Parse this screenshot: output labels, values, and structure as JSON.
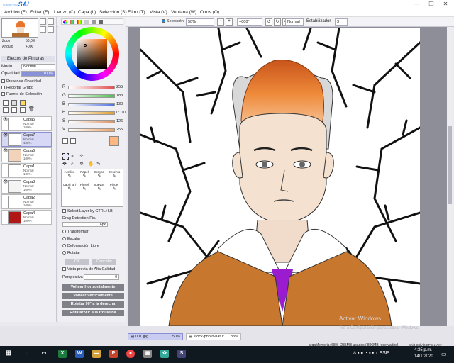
{
  "app": {
    "logo_small": "PaintTool",
    "logo_big": "SAI"
  },
  "window_controls": [
    "—",
    "❐",
    "✕"
  ],
  "menu": [
    "Archivo (F)",
    "Editar (E)",
    "Lienzo (C)",
    "Capa (L)",
    "Selección (S)",
    "Filtro (T)",
    "Vista (V)",
    "Ventana (W)",
    "Otros (O)"
  ],
  "toolbar": {
    "selection_label": "Selección",
    "zoom": "50%",
    "angle": "+000°",
    "mode": "Normal",
    "stabilizer_label": "Estabilizador",
    "stabilizer_value": "3"
  },
  "navigator": {
    "zoom_label": "Zoom",
    "zoom_value": "50,0%",
    "angle_label": "Angulo",
    "angle_value": "+000"
  },
  "paint_effects": {
    "header": "Efectos de Pinturas",
    "mode_label": "Modo",
    "mode_value": "Normal",
    "opacity_label": "Opacidad",
    "opacity_value": "100%",
    "preserve_opacity": "Preservar Opacidad",
    "clip_group": "Recortar Grupo",
    "selection_source": "Fuente de Selección"
  },
  "layers": [
    {
      "name": "Capa5",
      "mode": "Normal",
      "opacity": "100%",
      "visible": true,
      "selected": false,
      "thumb_color": "#ffffff"
    },
    {
      "name": "Capa7",
      "mode": "Normal",
      "opacity": "100%",
      "visible": true,
      "selected": true,
      "thumb_color": "#ffffff"
    },
    {
      "name": "Capa6",
      "mode": "Normal",
      "opacity": "100%",
      "visible": true,
      "selected": false,
      "thumb_color": "#f2d2b8"
    },
    {
      "name": "Capa1",
      "mode": "Normal",
      "opacity": "100%",
      "visible": false,
      "selected": false,
      "thumb_color": "#ffffff"
    },
    {
      "name": "Capa3",
      "mode": "Normal",
      "opacity": "100%",
      "visible": true,
      "selected": false,
      "thumb_color": "#f4f4f4"
    },
    {
      "name": "Capa2",
      "mode": "Normal",
      "opacity": "100%",
      "visible": false,
      "selected": false,
      "thumb_color": "#ffffff"
    },
    {
      "name": "Capa4",
      "mode": "Normal",
      "opacity": "100%",
      "visible": false,
      "selected": false,
      "thumb_color": "#b01818"
    }
  ],
  "color_sliders": [
    {
      "label": "R",
      "value": "255",
      "color": "#e05050"
    },
    {
      "label": "G",
      "value": "183",
      "color": "#50c050"
    },
    {
      "label": "B",
      "value": "130",
      "color": "#5070e0"
    },
    {
      "label": "H",
      "value": "0:110",
      "color": "#e0a030"
    },
    {
      "label": "S",
      "value": "126",
      "color": "#e09060"
    },
    {
      "label": "V",
      "value": "255",
      "color": "#f0a060"
    }
  ],
  "current_color": "#ffb782",
  "brush_tools": [
    "Acrílico",
    "Papel",
    "Crayon",
    "Desenfo",
    "Lapiz Bri",
    "Pinsel",
    "nuevos",
    "Pincel"
  ],
  "options": {
    "select_layer_ctrl": "Select Layer by CTRL+LB",
    "drag_detection": "Drag Detection Pix.",
    "drag_value": "16px",
    "transform": [
      "Transformar",
      "Escalar",
      "Deformación Libre",
      "Rotatar"
    ],
    "ok": "OK",
    "cancel": "Cancelar",
    "hq_preview": "Vista previa de Alta Calidad",
    "perspective_label": "Perspectiva",
    "perspective_value": "0",
    "buttons": [
      "Voltear Horizontalmente",
      "Voltear Verticalmente",
      "Rotatar 90° a la derecha",
      "Rotatar 90° a la izquierda"
    ]
  },
  "documents": [
    {
      "name": "001.jpg",
      "zoom": "50%"
    },
    {
      "name": "stock-photo-natur...",
      "zoom": "33%"
    }
  ],
  "status": {
    "memory": "argaMemoria: 68% (235MB usados / 896MB reservados)",
    "watermark1": "Activar Windows",
    "watermark2": "Ve a Configuración para activar Windows.",
    "keys": "Shift Ctrl Alt SPC ● Any"
  },
  "taskbar": {
    "time": "4:35 p.m.",
    "date": "14/1/2020"
  }
}
